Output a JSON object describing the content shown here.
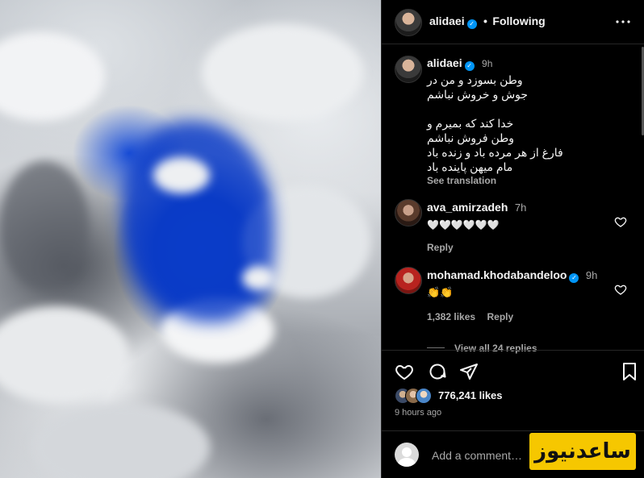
{
  "post": {
    "author": "alidaei",
    "follow_status": "Following",
    "separator": "•",
    "more_icon": "more-horizontal-icon"
  },
  "caption": {
    "username": "alidaei",
    "time": "9h",
    "lines": [
      "وطن بسوزد و من در",
      "جوش و خروش نباشم",
      "",
      "خدا کند که بمیرم و",
      "وطن فروش نباشم",
      "فارغ از هر مرده باد و زنده باد",
      "مام میهن پاینده باد"
    ],
    "see_translation": "See translation"
  },
  "comments": [
    {
      "username": "ava_amirzadeh",
      "time": "7h",
      "text": "🤍🤍🤍🤍🤍🤍",
      "reply_label": "Reply"
    },
    {
      "username": "mohamad.khodabandeloo",
      "time": "9h",
      "text": "👏👏",
      "likes": "1,382 likes",
      "reply_label": "Reply",
      "view_replies": "View all 24 replies"
    }
  ],
  "actions": {
    "like_icon": "heart-icon",
    "comment_icon": "comment-icon",
    "share_icon": "share-icon",
    "save_icon": "bookmark-icon"
  },
  "stats": {
    "likes": "776,241 likes",
    "posted": "9 hours ago"
  },
  "add_comment": {
    "placeholder": "Add a comment…"
  },
  "watermark": {
    "text": "ساعدنیوز"
  }
}
